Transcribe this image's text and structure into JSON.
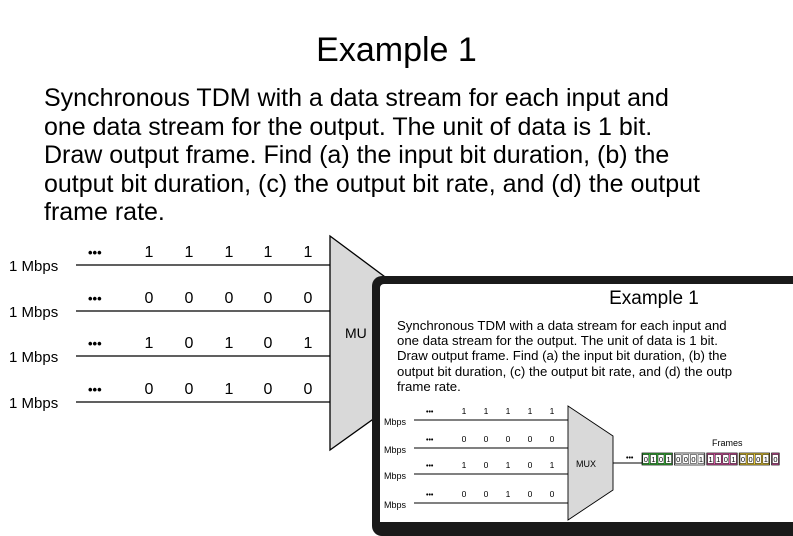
{
  "title": "Example 1",
  "paragraph": [
    "Synchronous TDM with a data stream for each input and",
    "one data stream for the output. The unit of data is 1 bit.",
    "Draw output frame. Find (a) the input bit duration, (b) the",
    "output bit duration, (c) the output bit rate, and (d) the output",
    "frame rate."
  ],
  "diagram": {
    "rate_labels": [
      "1 Mbps",
      "1 Mbps",
      "1 Mbps",
      "1 Mbps"
    ],
    "ellipsis": "•••",
    "streams": [
      [
        "1",
        "1",
        "1",
        "1",
        "1"
      ],
      [
        "0",
        "0",
        "0",
        "0",
        "0"
      ],
      [
        "1",
        "0",
        "1",
        "0",
        "1"
      ],
      [
        "0",
        "0",
        "1",
        "0",
        "0"
      ]
    ],
    "mux_label": "MU"
  },
  "thumbnail": {
    "title": "Example 1",
    "paragraph": [
      "Synchronous TDM with a data stream for each input and",
      "one data stream for the output. The unit of data is 1 bit.",
      "Draw output frame. Find (a) the input bit duration, (b) the",
      "output bit duration, (c) the output bit rate, and (d) the outp",
      "frame rate."
    ],
    "rate_labels": [
      "Mbps",
      "Mbps",
      "Mbps",
      "Mbps"
    ],
    "ellipsis": "•••",
    "streams": [
      [
        "1",
        "1",
        "1",
        "1",
        "1"
      ],
      [
        "0",
        "0",
        "0",
        "0",
        "0"
      ],
      [
        "1",
        "0",
        "1",
        "0",
        "1"
      ],
      [
        "0",
        "0",
        "1",
        "0",
        "0"
      ]
    ],
    "mux_label": "MUX",
    "frames_label": "Frames",
    "frames": [
      "0101",
      "0001",
      "1101",
      "0001",
      "0"
    ],
    "frame_colors": [
      "#3fbf3f",
      "#ffffff",
      "#e05aa8",
      "#f2d23a",
      "#e05aa8"
    ]
  }
}
